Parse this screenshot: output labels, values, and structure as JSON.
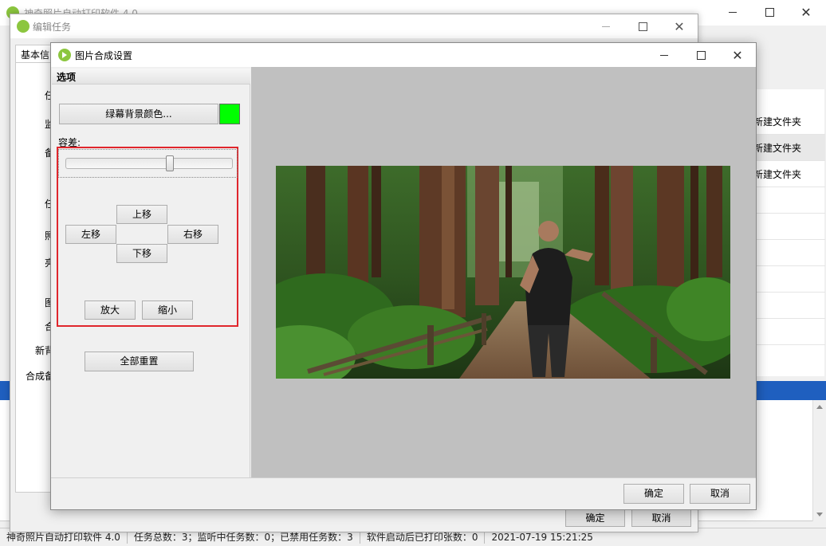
{
  "main_window": {
    "title": "神奇照片自动打印软件 4.0",
    "folder_rows": [
      "新建文件夹",
      "新建文件夹",
      "新建文件夹"
    ]
  },
  "status_bar": {
    "app_name": "神奇照片自动打印软件 4.0",
    "task_stats": "任务总数：3；监听中任务数：0；已禁用任务数：3",
    "printed_count": "软件启动后已打印张数：0",
    "timestamp": "2021-07-19 15:21:25"
  },
  "edit_window": {
    "title": "编辑任务",
    "tab_label": "基本信",
    "labels": [
      "任",
      "监",
      "备",
      "任",
      "照",
      "亮",
      "图",
      "合",
      "新背",
      "合成备"
    ],
    "ok_label": "确定",
    "cancel_label": "取消"
  },
  "dialog": {
    "title": "图片合成设置",
    "options_header": "选项",
    "green_bg_button": "绿幕背景颜色...",
    "swatch_color": "#00ff00",
    "tolerance_label": "容差:",
    "tolerance_value": 0.63,
    "move_up": "上移",
    "move_left": "左移",
    "move_right": "右移",
    "move_down": "下移",
    "zoom_in": "放大",
    "zoom_out": "缩小",
    "reset_all": "全部重置",
    "ok_label": "确定",
    "cancel_label": "取消"
  },
  "colors": {
    "highlight_border": "#e0262c",
    "preview_bg": "#c0c0c0",
    "log_header": "#1f5fbf"
  }
}
